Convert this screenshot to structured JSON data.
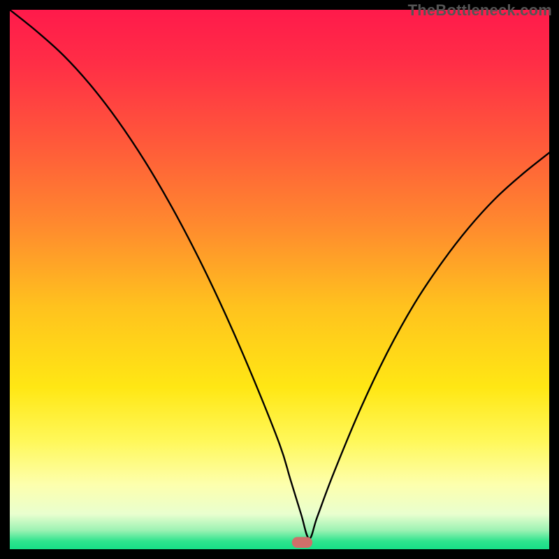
{
  "watermark": "TheBottleneck.com",
  "chart_data": {
    "type": "line",
    "title": "",
    "xlabel": "",
    "ylabel": "",
    "xlim": [
      0,
      100
    ],
    "ylim": [
      0,
      100
    ],
    "gradient_stops": [
      {
        "offset": 0.0,
        "color": "#ff1a4b"
      },
      {
        "offset": 0.1,
        "color": "#ff2e46"
      },
      {
        "offset": 0.25,
        "color": "#ff5a3a"
      },
      {
        "offset": 0.4,
        "color": "#ff8a2e"
      },
      {
        "offset": 0.55,
        "color": "#ffc21e"
      },
      {
        "offset": 0.7,
        "color": "#ffe714"
      },
      {
        "offset": 0.8,
        "color": "#fff85a"
      },
      {
        "offset": 0.88,
        "color": "#fdffad"
      },
      {
        "offset": 0.935,
        "color": "#e9ffcf"
      },
      {
        "offset": 0.965,
        "color": "#9cf2b3"
      },
      {
        "offset": 0.985,
        "color": "#2fe48e"
      },
      {
        "offset": 1.0,
        "color": "#17df87"
      }
    ],
    "series": [
      {
        "name": "bottleneck-curve",
        "x": [
          0,
          5,
          10,
          15,
          20,
          25,
          30,
          35,
          40,
          45,
          50,
          52,
          54,
          55.5,
          57,
          60,
          65,
          70,
          75,
          80,
          85,
          90,
          95,
          100
        ],
        "y": [
          100,
          96,
          91.5,
          86,
          79.5,
          72,
          63.5,
          54,
          43.5,
          32,
          19.5,
          13,
          6.5,
          2,
          6,
          14,
          26,
          36.5,
          45.5,
          53,
          59.5,
          65,
          69.5,
          73.5
        ]
      }
    ],
    "marker": {
      "x": 54.2,
      "width": 3.8,
      "height": 2.0,
      "rx": 1.0
    },
    "colors": {
      "frame": "#000000",
      "curve": "#000000",
      "marker": "#cf6f6a",
      "watermark": "#555555"
    }
  }
}
